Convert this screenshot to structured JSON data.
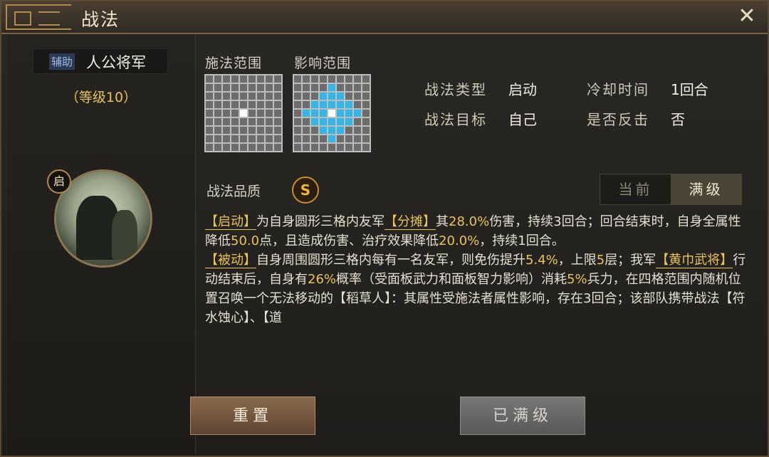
{
  "window": {
    "title": "战法",
    "close_symbol": "✕"
  },
  "general": {
    "role_tag": "辅助",
    "name": "人公将军",
    "level": "（等级10）",
    "skill_badge": "启"
  },
  "ranges": {
    "cast_label": "施法范围",
    "effect_label": "影响范围"
  },
  "info": {
    "type_label": "战法类型",
    "type_value": "启动",
    "cooldown_label": "冷却时间",
    "cooldown_value": "1回合",
    "target_label": "战法目标",
    "target_value": "自己",
    "counter_label": "是否反击",
    "counter_value": "否"
  },
  "quality": {
    "label": "战法品质",
    "grade": "S"
  },
  "toggle": {
    "current": "当前",
    "max": "满级",
    "selected": "max"
  },
  "description": {
    "p1": {
      "tag1": "【启动】",
      "t1": "为自身圆形三格内友军",
      "tag2": "【分摊】",
      "t2": "其",
      "n1": "28.0%",
      "t3": "伤害，持续3回合；回合结束时，自身全属性降低",
      "n2": "50.0",
      "t4": "点，且造成伤害、治疗效果降低",
      "n3": "20.0%",
      "t5": "，持续1回合。"
    },
    "p2": {
      "tag1": "【被动】",
      "t1": "自身周围圆形三格内每有一名友军，则免伤提升",
      "n1": "5.4%",
      "t2": "，上限",
      "n2": "5",
      "t3": "层；我军",
      "tag2": "【黄巾武将】",
      "t4": "行动结束后，自身有",
      "n3": "26%",
      "t5": "概率（受面板武力和面板智力影响）消耗",
      "n4": "5%",
      "t6": "兵力，在四格范围内随机位置召唤一个无法移动的【稻草人】：其属性受施法者属性影响，存在3回合；该部队携带战法【符水蚀心】、【道"
    }
  },
  "buttons": {
    "reset": "重置",
    "maxed": "已满级"
  },
  "colors": {
    "highlight": "#e8c25a",
    "range_blue": "#33b6e6",
    "grade": "#f0b53b"
  }
}
